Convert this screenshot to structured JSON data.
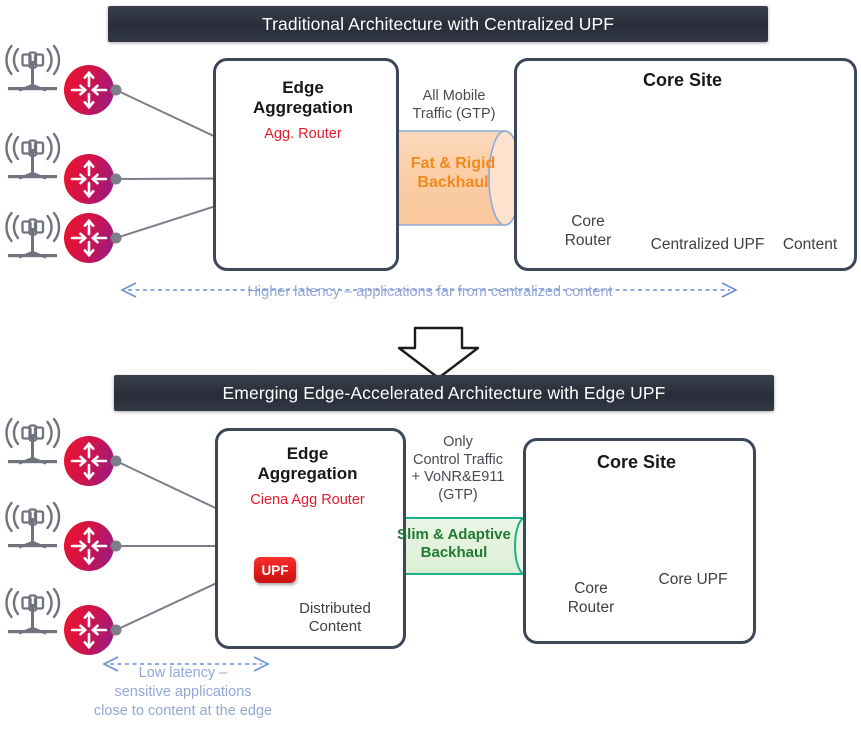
{
  "top": {
    "banner": "Traditional Architecture with Centralized UPF",
    "edge_box_title_line1": "Edge",
    "edge_box_title_line2": "Aggregation",
    "agg_router_label": "Agg. Router",
    "traffic_label_line1": "All Mobile",
    "traffic_label_line2": "Traffic (GTP)",
    "backhaul_line1": "Fat & Rigid",
    "backhaul_line2": "Backhaul",
    "core_site_title": "Core Site",
    "core_router_line1": "Core",
    "core_router_line2": "Router",
    "upf_stack_label": "Centralized UPF",
    "content_stack_label": "Content",
    "latency_note": "Higher latency – applications far from centralized content"
  },
  "bottom": {
    "banner": "Emerging Edge-Accelerated Architecture with Edge UPF",
    "edge_box_title_line1": "Edge",
    "edge_box_title_line2": "Aggregation",
    "agg_router_label": "Ciena Agg Router",
    "upf_badge": "UPF",
    "distributed_content_line1": "Distributed",
    "distributed_content_line2": "Content",
    "traffic_label_line1": "Only",
    "traffic_label_line2": "Control Traffic",
    "traffic_label_line3": "+ VoNR&E911",
    "traffic_label_line4": "(GTP)",
    "backhaul_line1": "Slim & Adaptive",
    "backhaul_line2": "Backhaul",
    "core_site_title": "Core Site",
    "core_router_line1": "Core",
    "core_router_line2": "Router",
    "core_upf_label": "Core UPF",
    "latency_note_line1": "Low latency –",
    "latency_note_line2": "sensitive applications",
    "latency_note_line3": "close to content at the edge"
  },
  "icons": {
    "antenna": "cell-tower-icon",
    "router": "router-node-icon",
    "core_router": "core-router-node-icon",
    "server": "server-rack-icon",
    "transition_arrow": "down-arrow-icon"
  },
  "colors": {
    "banner_bg": "#2b303c",
    "box_border": "#3d4759",
    "router_red": "#e1183c",
    "router_purple": "#a01a7d",
    "core_router_dark": "#3f424e",
    "link_gray": "#7b7f89",
    "server_orange_fill": "#f8b183",
    "server_orange_stroke": "#c55a11",
    "server_blue_fill": "#b4b8f0",
    "server_blue_stroke": "#4a4ab8",
    "backhaul_orange_fill": "#fbd5b5",
    "backhaul_orange_text": "#f08a1c",
    "backhaul_green_fill": "#e2f0dd",
    "backhaul_green_stroke": "#19b18a",
    "backhaul_green_text": "#1f7a33",
    "latency_blue": "#93a8d8",
    "sub_label_red": "#e8192c",
    "upf_red": "#e21b18",
    "antenna_gray": "#6e737d"
  }
}
